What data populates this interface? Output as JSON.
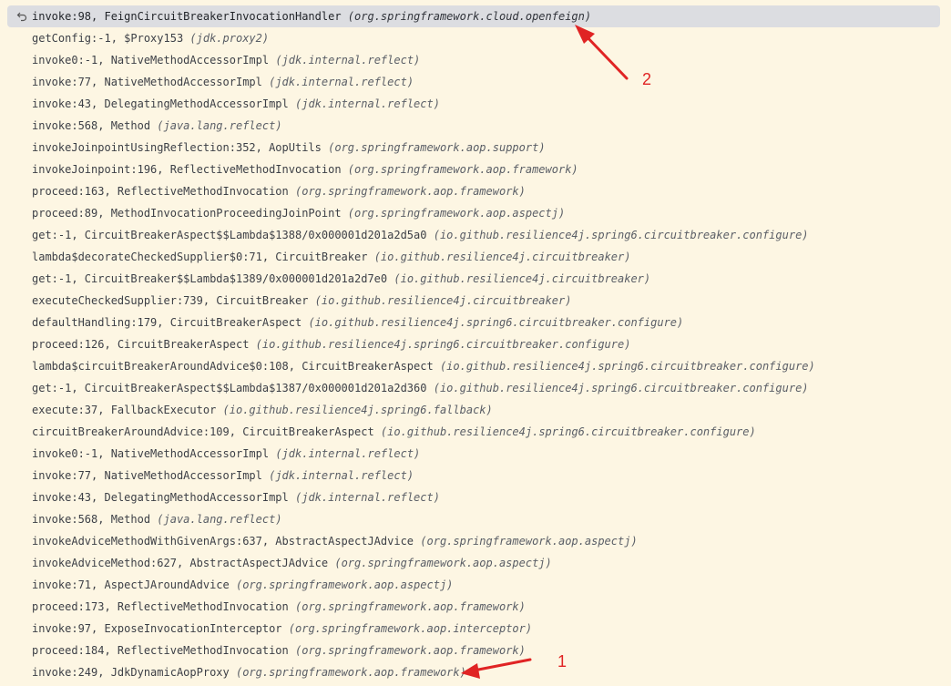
{
  "frames": [
    {
      "method": "invoke:98, FeignCircuitBreakerInvocationHandler",
      "pkg": "(org.springframework.cloud.openfeign)",
      "current": true,
      "icon": "return-arrow-icon"
    },
    {
      "method": "getConfig:-1, $Proxy153",
      "pkg": "(jdk.proxy2)"
    },
    {
      "method": "invoke0:-1, NativeMethodAccessorImpl",
      "pkg": "(jdk.internal.reflect)"
    },
    {
      "method": "invoke:77, NativeMethodAccessorImpl",
      "pkg": "(jdk.internal.reflect)"
    },
    {
      "method": "invoke:43, DelegatingMethodAccessorImpl",
      "pkg": "(jdk.internal.reflect)"
    },
    {
      "method": "invoke:568, Method",
      "pkg": "(java.lang.reflect)"
    },
    {
      "method": "invokeJoinpointUsingReflection:352, AopUtils",
      "pkg": "(org.springframework.aop.support)"
    },
    {
      "method": "invokeJoinpoint:196, ReflectiveMethodInvocation",
      "pkg": "(org.springframework.aop.framework)"
    },
    {
      "method": "proceed:163, ReflectiveMethodInvocation",
      "pkg": "(org.springframework.aop.framework)"
    },
    {
      "method": "proceed:89, MethodInvocationProceedingJoinPoint",
      "pkg": "(org.springframework.aop.aspectj)"
    },
    {
      "method": "get:-1, CircuitBreakerAspect$$Lambda$1388/0x000001d201a2d5a0",
      "pkg": "(io.github.resilience4j.spring6.circuitbreaker.configure)"
    },
    {
      "method": "lambda$decorateCheckedSupplier$0:71, CircuitBreaker",
      "pkg": "(io.github.resilience4j.circuitbreaker)"
    },
    {
      "method": "get:-1, CircuitBreaker$$Lambda$1389/0x000001d201a2d7e0",
      "pkg": "(io.github.resilience4j.circuitbreaker)"
    },
    {
      "method": "executeCheckedSupplier:739, CircuitBreaker",
      "pkg": "(io.github.resilience4j.circuitbreaker)"
    },
    {
      "method": "defaultHandling:179, CircuitBreakerAspect",
      "pkg": "(io.github.resilience4j.spring6.circuitbreaker.configure)"
    },
    {
      "method": "proceed:126, CircuitBreakerAspect",
      "pkg": "(io.github.resilience4j.spring6.circuitbreaker.configure)"
    },
    {
      "method": "lambda$circuitBreakerAroundAdvice$0:108, CircuitBreakerAspect",
      "pkg": "(io.github.resilience4j.spring6.circuitbreaker.configure)"
    },
    {
      "method": "get:-1, CircuitBreakerAspect$$Lambda$1387/0x000001d201a2d360",
      "pkg": "(io.github.resilience4j.spring6.circuitbreaker.configure)"
    },
    {
      "method": "execute:37, FallbackExecutor",
      "pkg": "(io.github.resilience4j.spring6.fallback)"
    },
    {
      "method": "circuitBreakerAroundAdvice:109, CircuitBreakerAspect",
      "pkg": "(io.github.resilience4j.spring6.circuitbreaker.configure)"
    },
    {
      "method": "invoke0:-1, NativeMethodAccessorImpl",
      "pkg": "(jdk.internal.reflect)"
    },
    {
      "method": "invoke:77, NativeMethodAccessorImpl",
      "pkg": "(jdk.internal.reflect)"
    },
    {
      "method": "invoke:43, DelegatingMethodAccessorImpl",
      "pkg": "(jdk.internal.reflect)"
    },
    {
      "method": "invoke:568, Method",
      "pkg": "(java.lang.reflect)"
    },
    {
      "method": "invokeAdviceMethodWithGivenArgs:637, AbstractAspectJAdvice",
      "pkg": "(org.springframework.aop.aspectj)"
    },
    {
      "method": "invokeAdviceMethod:627, AbstractAspectJAdvice",
      "pkg": "(org.springframework.aop.aspectj)"
    },
    {
      "method": "invoke:71, AspectJAroundAdvice",
      "pkg": "(org.springframework.aop.aspectj)"
    },
    {
      "method": "proceed:173, ReflectiveMethodInvocation",
      "pkg": "(org.springframework.aop.framework)"
    },
    {
      "method": "invoke:97, ExposeInvocationInterceptor",
      "pkg": "(org.springframework.aop.interceptor)"
    },
    {
      "method": "proceed:184, ReflectiveMethodInvocation",
      "pkg": "(org.springframework.aop.framework)"
    },
    {
      "method": "invoke:249, JdkDynamicAopProxy",
      "pkg": "(org.springframework.aop.framework)"
    }
  ],
  "annotations": {
    "label_1": "1",
    "label_2": "2",
    "color": "#e02424"
  },
  "colors": {
    "background": "#fdf6e3",
    "current_frame": "#dcdde1"
  }
}
